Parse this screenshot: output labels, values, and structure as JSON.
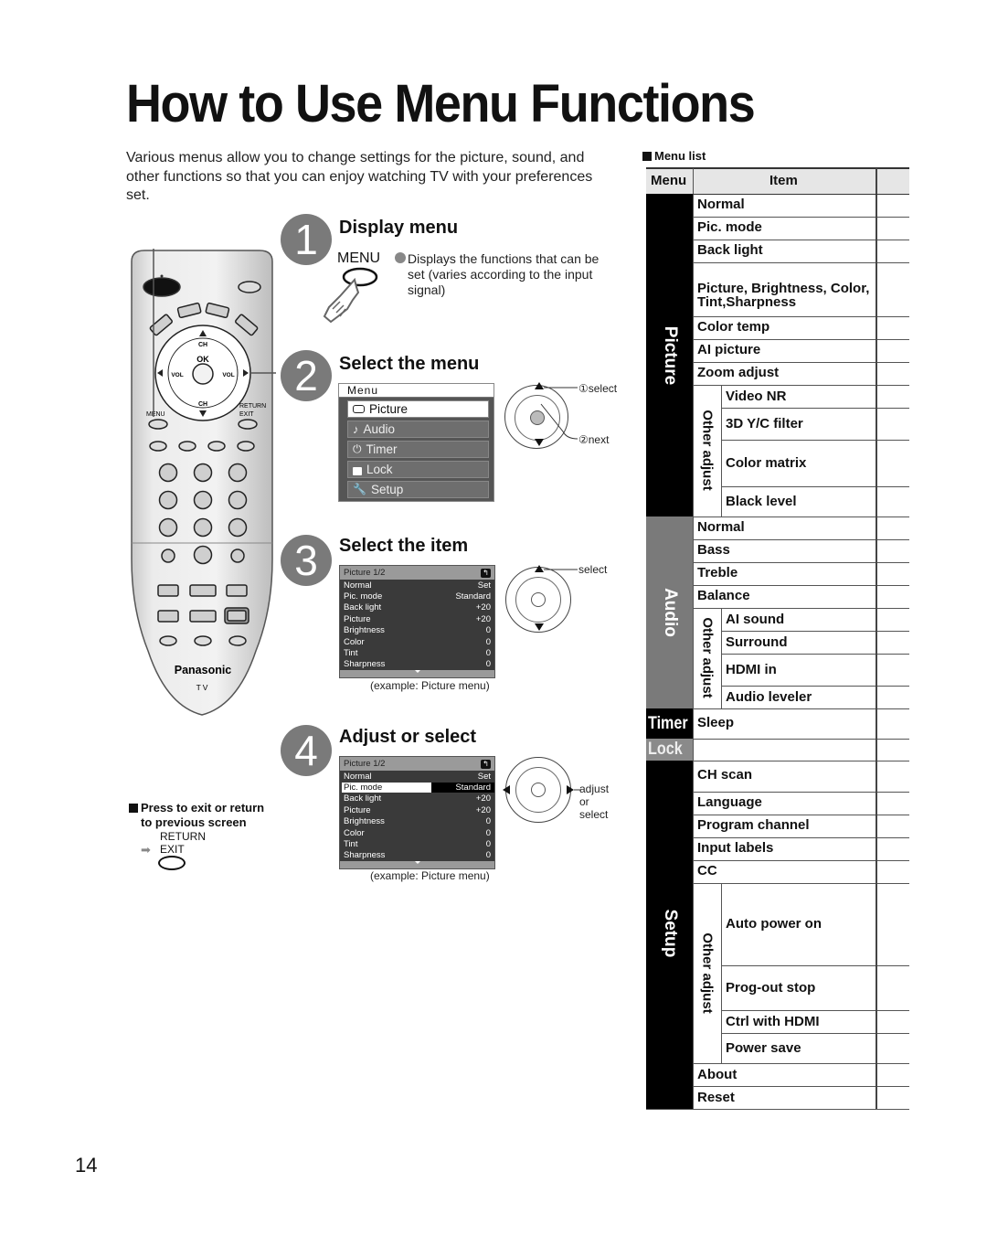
{
  "page": {
    "title": "How to Use Menu Functions",
    "intro": "Various menus allow you to change settings for the picture, sound, and other functions so that you can enjoy watching TV with your preferences set.",
    "page_number": "14"
  },
  "remote": {
    "brand": "Panasonic",
    "model_label": "TV",
    "labels": {
      "ch_up": "CH",
      "ch_down": "CH",
      "ok": "OK",
      "vol_left": "VOL",
      "vol_right": "VOL",
      "menu": "MENU",
      "return": "RETURN",
      "exit": "EXIT"
    }
  },
  "steps": [
    {
      "number": "1",
      "title": "Display menu",
      "button_label": "MENU",
      "note": "Displays the functions that can be set (varies according to the input signal)"
    },
    {
      "number": "2",
      "title": "Select the menu",
      "hint_select": "①select",
      "hint_next": "②next"
    },
    {
      "number": "3",
      "title": "Select the item",
      "hint_select": "select",
      "caption": "(example: Picture menu)"
    },
    {
      "number": "4",
      "title": "Adjust or select",
      "hint": [
        "adjust",
        "or",
        "select"
      ],
      "caption": "(example: Picture menu)"
    }
  ],
  "main_menu": {
    "title": "Menu",
    "items": [
      {
        "label": "Picture",
        "icon": "tv-icon",
        "selected": true
      },
      {
        "label": "Audio",
        "icon": "music-note-icon",
        "selected": false
      },
      {
        "label": "Timer",
        "icon": "power-icon",
        "selected": false
      },
      {
        "label": "Lock",
        "icon": "lock-icon",
        "selected": false
      },
      {
        "label": "Setup",
        "icon": "wrench-icon",
        "selected": false
      }
    ]
  },
  "picture_menu": {
    "title": "Picture   1/2",
    "rows": [
      {
        "key": "Normal",
        "value": "Set"
      },
      {
        "key": "Pic. mode",
        "value": "Standard"
      },
      {
        "key": "Back light",
        "value": "+20"
      },
      {
        "key": "Picture",
        "value": "+20"
      },
      {
        "key": "Brightness",
        "value": "0"
      },
      {
        "key": "Color",
        "value": "0"
      },
      {
        "key": "Tint",
        "value": "0"
      },
      {
        "key": "Sharpness",
        "value": "0"
      }
    ],
    "highlighted_in_step4": "Pic. mode"
  },
  "exit_note": {
    "text": "Press to exit or return to previous screen",
    "line1": "Press to exit or return",
    "line2": "to previous screen",
    "button_line1": "RETURN",
    "button_line2": "EXIT"
  },
  "menu_list": {
    "heading": "Menu list",
    "col_menu": "Menu",
    "col_item": "Item",
    "other_adjust_label": "Other adjust",
    "categories": [
      {
        "name": "Picture",
        "items": [
          "Normal",
          "Pic. mode",
          "Back light",
          "Picture, Brightness, Color, Tint,Sharpness",
          "Color temp",
          "AI picture",
          "Zoom adjust"
        ],
        "other_adjust": [
          "Video NR",
          "3D Y/C filter",
          "Color matrix",
          "Black level"
        ]
      },
      {
        "name": "Audio",
        "items": [
          "Normal",
          "Bass",
          "Treble",
          "Balance"
        ],
        "other_adjust": [
          "AI sound",
          "Surround",
          "HDMI in",
          "Audio leveler"
        ]
      },
      {
        "name": "Timer",
        "items": [
          "Sleep"
        ]
      },
      {
        "name": "Lock",
        "items": [
          ""
        ]
      },
      {
        "name": "Setup",
        "items": [
          "CH scan",
          "Language",
          "Program channel",
          "Input labels",
          "CC"
        ],
        "other_adjust": [
          "Auto power on",
          "Prog-out stop",
          "Ctrl with HDMI",
          "Power save"
        ],
        "items_after": [
          "About",
          "Reset"
        ]
      }
    ]
  }
}
